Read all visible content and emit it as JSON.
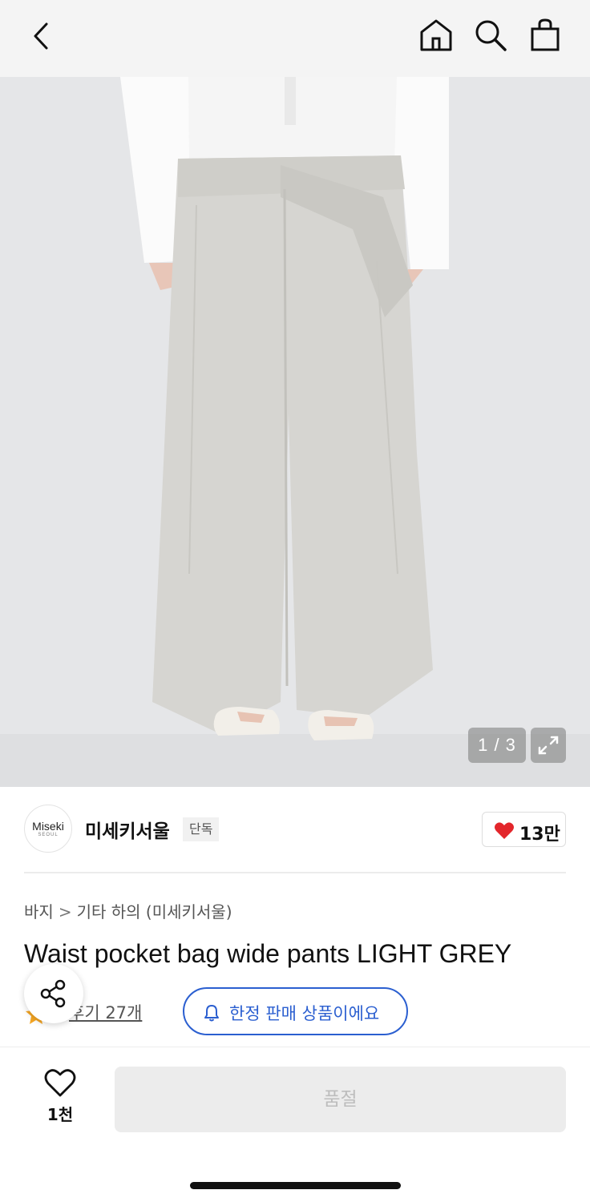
{
  "topbar": {
    "back_icon": "chevron-left-icon",
    "home_icon": "home-icon",
    "search_icon": "search-icon",
    "bag_icon": "shopping-bag-icon"
  },
  "gallery": {
    "counter": "1 / 3",
    "expand_icon": "expand-icon"
  },
  "brand": {
    "logo_text": "Miseki",
    "logo_sub": "SEOUL",
    "name": "미세키서울",
    "badge": "단독",
    "likes": "13만",
    "heart_color": "#e3262b"
  },
  "breadcrumb": {
    "category": "바지",
    "subcategory": "기타 하의 (미세키서울)"
  },
  "product": {
    "title": "Waist pocket bag wide pants LIGHT GREY",
    "review_text": "후기 27개",
    "limited_label": "한정 판매 상품이에요",
    "accent": "#2b5fd0"
  },
  "bottom": {
    "wish_count": "1천",
    "soldout_label": "품절"
  }
}
